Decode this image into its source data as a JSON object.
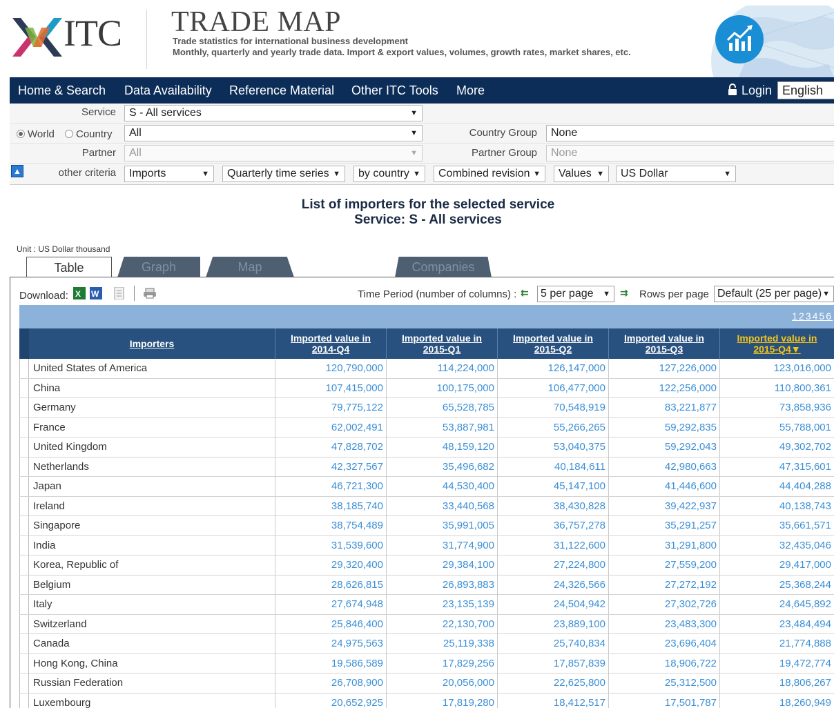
{
  "header": {
    "logo_text": "ITC",
    "title": "TRADE MAP",
    "subtitle": "Trade statistics for international business development",
    "description": "Monthly, quarterly and yearly trade data. Import & export values, volumes, growth rates, market shares, etc."
  },
  "nav": {
    "items": [
      "Home & Search",
      "Data Availability",
      "Reference Material",
      "Other ITC Tools",
      "More"
    ],
    "login": "Login",
    "language": "English"
  },
  "criteria": {
    "service_label": "Service",
    "service_value": "S - All services",
    "world_label": "World",
    "country_label": "Country",
    "country_value": "All",
    "country_group_label": "Country Group",
    "country_group_value": "None",
    "partner_label": "Partner",
    "partner_value": "All",
    "partner_group_label": "Partner Group",
    "partner_group_value": "None",
    "other_label": "other criteria",
    "flow": "Imports",
    "series": "Quarterly time series",
    "by": "by country",
    "revision": "Combined revision",
    "measure": "Values",
    "currency": "US Dollar"
  },
  "title": {
    "line1": "List of importers for the selected service",
    "line2": "Service: S - All services"
  },
  "unit": "Unit : US Dollar thousand",
  "tabs": [
    "Table",
    "Graph",
    "Map",
    "Companies"
  ],
  "toolbar": {
    "download_label": "Download:",
    "time_period_label": "Time Period (number of columns) :",
    "per_page": "5 per page",
    "rows_label": "Rows per page",
    "rows_value": "Default (25 per page)"
  },
  "pager": [
    "1",
    "2",
    "3",
    "4",
    "5",
    "6"
  ],
  "table": {
    "col_importers": "Importers",
    "columns": [
      {
        "l1": "Imported value in",
        "l2": "2014-Q4"
      },
      {
        "l1": "Imported value in",
        "l2": "2015-Q1"
      },
      {
        "l1": "Imported value in",
        "l2": "2015-Q2"
      },
      {
        "l1": "Imported value in",
        "l2": "2015-Q3"
      },
      {
        "l1": "Imported value in",
        "l2": "2015-Q4▼"
      }
    ],
    "rows": [
      {
        "name": "United States of America",
        "v": [
          "120,790,000",
          "114,224,000",
          "126,147,000",
          "127,226,000",
          "123,016,000"
        ]
      },
      {
        "name": "China",
        "v": [
          "107,415,000",
          "100,175,000",
          "106,477,000",
          "122,256,000",
          "110,800,361"
        ]
      },
      {
        "name": "Germany",
        "v": [
          "79,775,122",
          "65,528,785",
          "70,548,919",
          "83,221,877",
          "73,858,936"
        ]
      },
      {
        "name": "France",
        "v": [
          "62,002,491",
          "53,887,981",
          "55,266,265",
          "59,292,835",
          "55,788,001"
        ]
      },
      {
        "name": "United Kingdom",
        "v": [
          "47,828,702",
          "48,159,120",
          "53,040,375",
          "59,292,043",
          "49,302,702"
        ]
      },
      {
        "name": "Netherlands",
        "v": [
          "42,327,567",
          "35,496,682",
          "40,184,611",
          "42,980,663",
          "47,315,601"
        ]
      },
      {
        "name": "Japan",
        "v": [
          "46,721,300",
          "44,530,400",
          "45,147,100",
          "41,446,600",
          "44,404,288"
        ]
      },
      {
        "name": "Ireland",
        "v": [
          "38,185,740",
          "33,440,568",
          "38,430,828",
          "39,422,937",
          "40,138,743"
        ]
      },
      {
        "name": "Singapore",
        "v": [
          "38,754,489",
          "35,991,005",
          "36,757,278",
          "35,291,257",
          "35,661,571"
        ]
      },
      {
        "name": "India",
        "v": [
          "31,539,600",
          "31,774,900",
          "31,122,600",
          "31,291,800",
          "32,435,046"
        ]
      },
      {
        "name": "Korea, Republic of",
        "v": [
          "29,320,400",
          "29,384,100",
          "27,224,800",
          "27,559,200",
          "29,417,000"
        ]
      },
      {
        "name": "Belgium",
        "v": [
          "28,626,815",
          "26,893,883",
          "24,326,566",
          "27,272,192",
          "25,368,244"
        ]
      },
      {
        "name": "Italy",
        "v": [
          "27,674,948",
          "23,135,139",
          "24,504,942",
          "27,302,726",
          "24,645,892"
        ]
      },
      {
        "name": "Switzerland",
        "v": [
          "25,846,400",
          "22,130,700",
          "23,889,100",
          "23,483,300",
          "23,484,494"
        ]
      },
      {
        "name": "Canada",
        "v": [
          "24,975,563",
          "25,119,338",
          "25,740,834",
          "23,696,404",
          "21,774,888"
        ]
      },
      {
        "name": "Hong Kong, China",
        "v": [
          "19,586,589",
          "17,829,256",
          "17,857,839",
          "18,906,722",
          "19,472,774"
        ]
      },
      {
        "name": "Russian Federation",
        "v": [
          "26,708,900",
          "20,056,000",
          "22,625,800",
          "25,312,500",
          "18,806,267"
        ]
      },
      {
        "name": "Luxembourg",
        "v": [
          "20,652,925",
          "17,819,280",
          "18,412,517",
          "17,501,787",
          "18,260,949"
        ]
      }
    ]
  }
}
